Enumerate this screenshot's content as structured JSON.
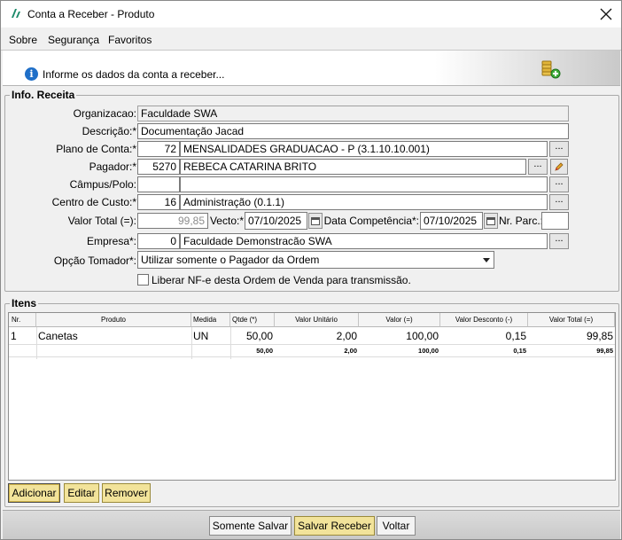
{
  "window": {
    "title": "Conta a Receber - Produto",
    "close_glyph": "✕"
  },
  "menu": [
    {
      "label": "Sobre"
    },
    {
      "label": "Segurança"
    },
    {
      "label": "Favoritos"
    }
  ],
  "banner": {
    "info_icon": "info-icon",
    "message": "Informe os dados da conta a receber...",
    "icon": "coins-add-icon"
  },
  "info_receita": {
    "title": "Info. Receita",
    "organizacao": {
      "label": "Organizacao:",
      "value": "Faculdade SWA"
    },
    "descricao": {
      "label": "Descrição:*",
      "value": "Documentação Jacad"
    },
    "plano_conta": {
      "label": "Plano de Conta:*",
      "code": "72",
      "value": "MENSALIDADES GRADUACAO - P (3.1.10.10.001)"
    },
    "pagador": {
      "label": "Pagador:*",
      "code": "5270",
      "value": "REBECA CATARINA BRITO"
    },
    "campus": {
      "label": "Câmpus/Polo:",
      "code": "",
      "value": ""
    },
    "centro_custo": {
      "label": "Centro de Custo:*",
      "code": "16",
      "value": "Administração (0.1.1)"
    },
    "valor_total": {
      "label": "Valor Total (=):",
      "value": "99,85"
    },
    "vecto": {
      "label": "Vecto:*",
      "value": "07/10/2025"
    },
    "data_competencia": {
      "label": "Data Competência*:",
      "value": "07/10/2025"
    },
    "nr_parc": {
      "label": "Nr. Parc.:",
      "value": ""
    },
    "empresa": {
      "label": "Empresa*:",
      "code": "0",
      "value": "Faculdade Demonstracão SWA"
    },
    "opcao_tomador": {
      "label": "Opção Tomador*:",
      "value": "Utilizar somente o Pagador da Ordem"
    },
    "liberar_nfe": {
      "label": "Liberar NF-e desta Ordem de Venda para transmissão.",
      "checked": false
    },
    "ellipsis": "..."
  },
  "itens": {
    "title": "Itens",
    "columns": [
      "Nr.",
      "Produto",
      "Medida",
      "Qtde (*)",
      "Valor Unitário",
      "Valor (=)",
      "Valor Desconto (-)",
      "Valor Total (=)"
    ],
    "rows": [
      {
        "nr": "1",
        "produto": "Canetas",
        "medida": "UN",
        "qtde": "50,00",
        "valor_unitario": "2,00",
        "valor": "100,00",
        "desconto": "0,15",
        "total": "99,85"
      }
    ],
    "totals": {
      "qtde": "50,00",
      "valor_unitario": "2,00",
      "valor": "100,00",
      "desconto": "0,15",
      "total": "99,85"
    }
  },
  "actions": {
    "adicionar": "Adicionar",
    "editar": "Editar",
    "remover": "Remover"
  },
  "footer": {
    "somente_salvar": "Somente Salvar",
    "salvar_receber": "Salvar Receber",
    "voltar": "Voltar"
  }
}
